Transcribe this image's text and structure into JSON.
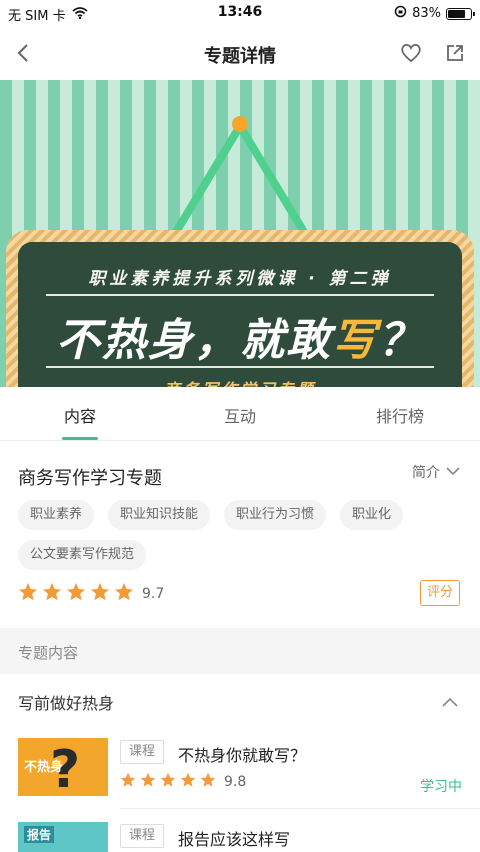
{
  "status_bar": {
    "carrier": "无 SIM 卡",
    "time": "13:46",
    "battery": "83%",
    "battery_level": 0.83
  },
  "navbar": {
    "title": "专题详情"
  },
  "banner": {
    "line1": "职业素养提升系列微课 · 第二弹",
    "line2_main": "不热身，就敢",
    "line2_highlight": "写",
    "line2_end": "？",
    "line3": "——商务写作学习专题——"
  },
  "tabs": [
    {
      "label": "内容",
      "active": true
    },
    {
      "label": "互动",
      "active": false
    },
    {
      "label": "排行榜",
      "active": false
    }
  ],
  "topic": {
    "title": "商务写作学习专题",
    "intro_label": "简介",
    "tags": [
      "职业素养",
      "职业知识技能",
      "职业行为习惯",
      "职业化",
      "公文要素写作规范"
    ],
    "rating_stars": 5,
    "score": "9.7",
    "rate_button": "评分"
  },
  "section": {
    "title": "专题内容"
  },
  "chapter": {
    "title": "写前做好热身"
  },
  "courses": [
    {
      "type": "课程",
      "title": "不热身你就敢写？",
      "thumb_text": "不热身",
      "stars": 5,
      "score": "9.8",
      "status": "学习中"
    },
    {
      "type": "课程",
      "title": "报告应该这样写",
      "thumb_text": "报告",
      "stars": 0,
      "score": "",
      "status": ""
    }
  ],
  "colors": {
    "accent": "#3cc08c",
    "star": "#f39a3a",
    "rate_button": "#f39a3a"
  }
}
